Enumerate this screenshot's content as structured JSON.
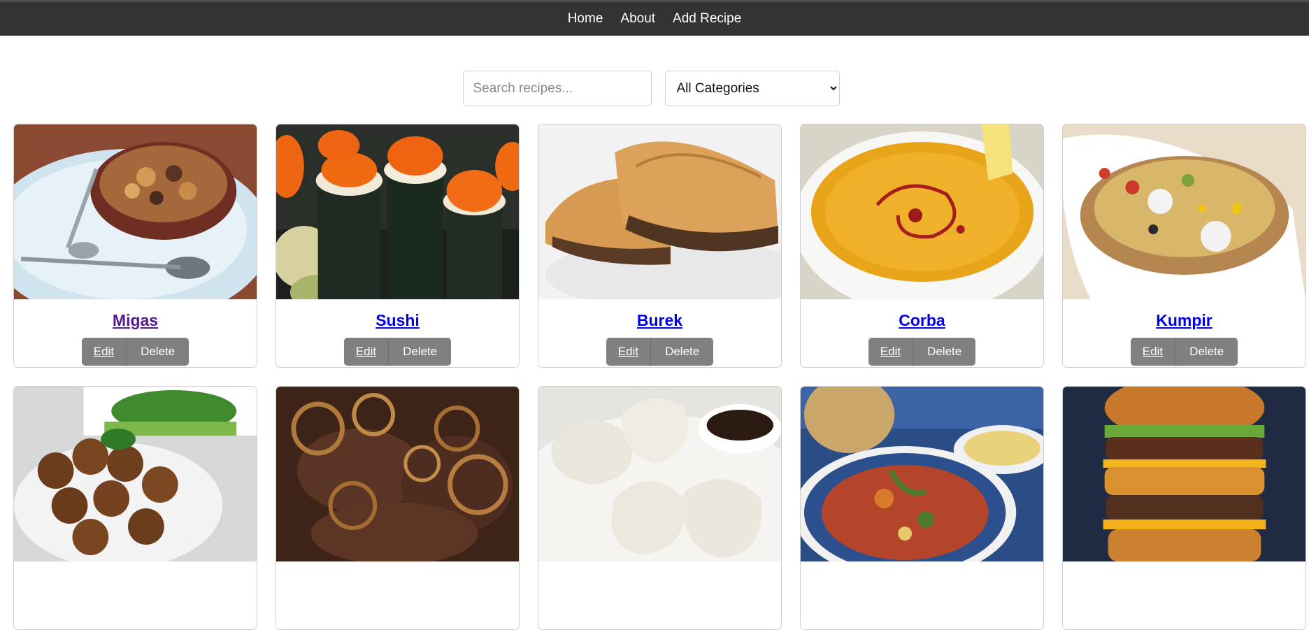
{
  "nav": {
    "items": [
      "Home",
      "About",
      "Add Recipe"
    ]
  },
  "search": {
    "placeholder": "Search recipes...",
    "value": ""
  },
  "category_filter": {
    "selected": "All Categories"
  },
  "card_actions": {
    "edit_label": "Edit",
    "delete_label": "Delete"
  },
  "recipes": [
    {
      "title": "Migas",
      "visited": true,
      "image": "migas"
    },
    {
      "title": "Sushi",
      "visited": false,
      "image": "sushi"
    },
    {
      "title": "Burek",
      "visited": false,
      "image": "burek"
    },
    {
      "title": "Corba",
      "visited": false,
      "image": "corba"
    },
    {
      "title": "Kumpir",
      "visited": false,
      "image": "kumpir"
    },
    {
      "title": "",
      "image": "falafel"
    },
    {
      "title": "",
      "image": "liver-onions"
    },
    {
      "title": "",
      "image": "dumplings"
    },
    {
      "title": "",
      "image": "stew-plate"
    },
    {
      "title": "",
      "image": "burger"
    }
  ]
}
